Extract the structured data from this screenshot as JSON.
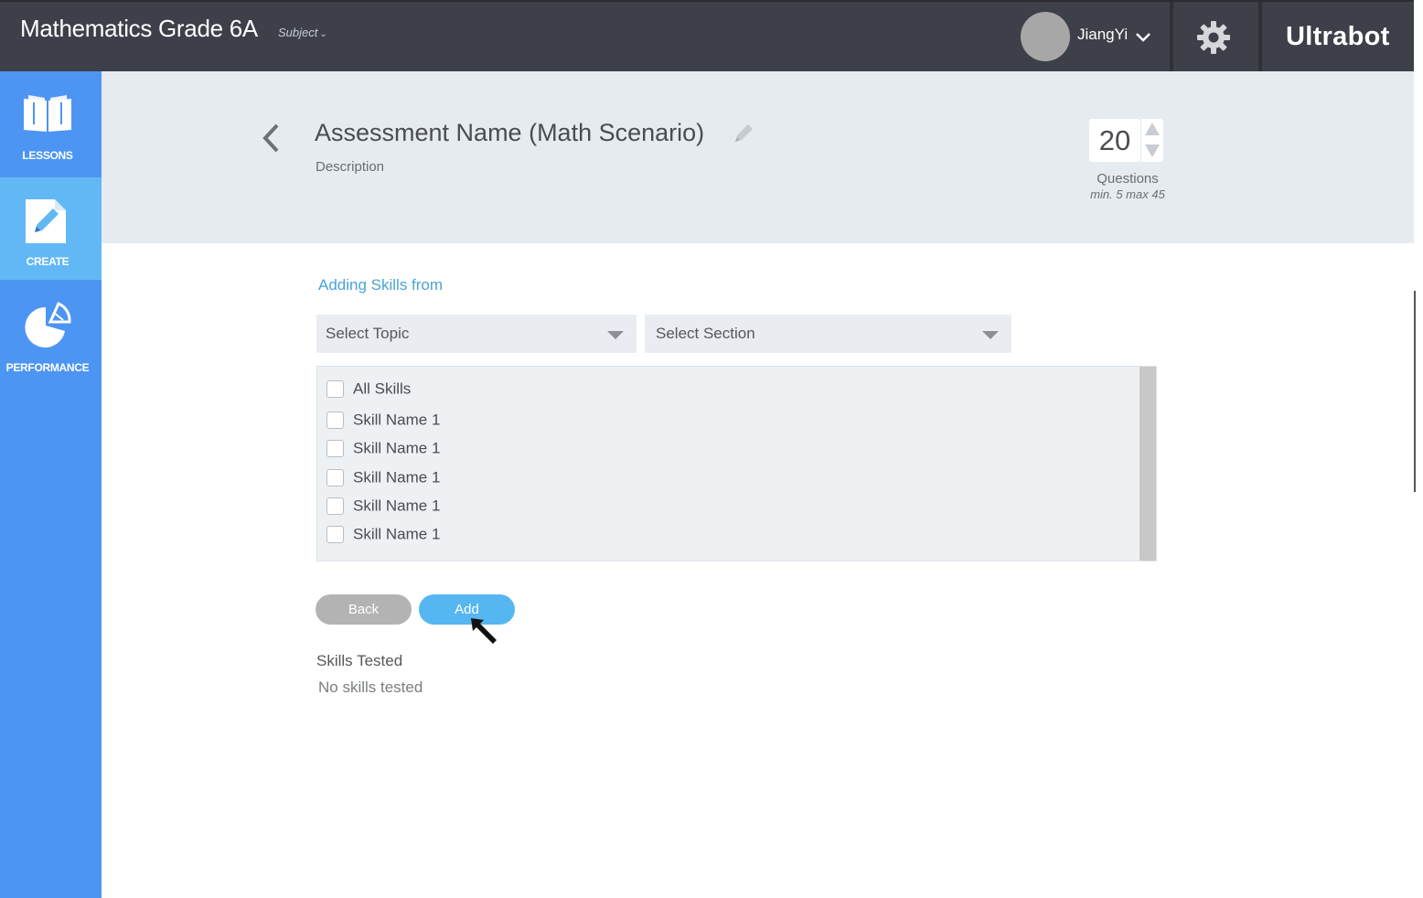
{
  "topbar": {
    "app_title": "Mathematics Grade 6A",
    "subject_label": "Subject",
    "username": "JiangYi",
    "brand": "Ultrabot",
    "background_color": "#3d4049"
  },
  "sidebar": {
    "background_color": "#4d95f2",
    "active_color": "#62b8f5",
    "items": [
      {
        "label": "LESSONS",
        "icon": "book-icon"
      },
      {
        "label": "CREATE",
        "icon": "pencil-note-icon",
        "active": true
      },
      {
        "label": "PERFORMANCE",
        "icon": "pie-chart-icon"
      }
    ]
  },
  "assessment": {
    "title": "Assessment Name (Math Scenario)",
    "description": "Description",
    "question_count": "20",
    "questions_label": "Questions",
    "questions_range": "min. 5 max 45"
  },
  "skills_picker": {
    "heading": "Adding Skills from",
    "topic_placeholder": "Select Topic",
    "section_placeholder": "Select Section",
    "skills": [
      {
        "label": "All Skills",
        "checked": false
      },
      {
        "label": "Skill Name 1",
        "checked": false
      },
      {
        "label": "Skill Name 1",
        "checked": false
      },
      {
        "label": "Skill Name 1",
        "checked": false
      },
      {
        "label": "Skill Name 1",
        "checked": false
      },
      {
        "label": "Skill Name 1",
        "checked": false
      }
    ]
  },
  "actions": {
    "back_label": "Back",
    "add_label": "Add"
  },
  "skills_tested": {
    "title": "Skills Tested",
    "value": "No skills tested"
  }
}
